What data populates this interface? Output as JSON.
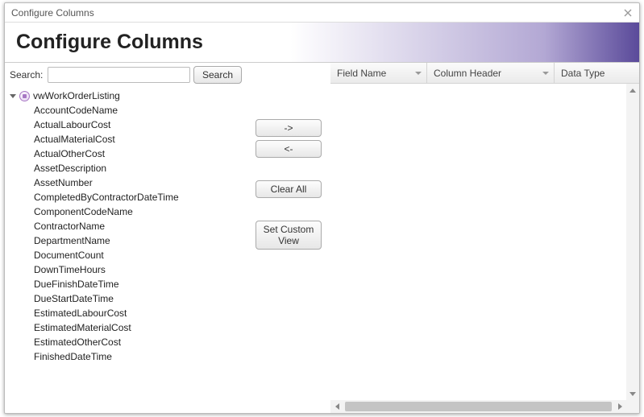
{
  "titlebar": {
    "title": "Configure Columns"
  },
  "header": {
    "title": "Configure Columns"
  },
  "search": {
    "label": "Search:",
    "value": "",
    "button": "Search"
  },
  "tree": {
    "root": "vwWorkOrderListing",
    "items": [
      "AccountCodeName",
      "ActualLabourCost",
      "ActualMaterialCost",
      "ActualOtherCost",
      "AssetDescription",
      "AssetNumber",
      "CompletedByContractorDateTime",
      "ComponentCodeName",
      "ContractorName",
      "DepartmentName",
      "DocumentCount",
      "DownTimeHours",
      "DueFinishDateTime",
      "DueStartDateTime",
      "EstimatedLabourCost",
      "EstimatedMaterialCost",
      "EstimatedOtherCost",
      "FinishedDateTime"
    ]
  },
  "buttons": {
    "add": "->",
    "remove": "<-",
    "clear": "Clear All",
    "custom": "Set Custom View"
  },
  "grid": {
    "columns": {
      "field": "Field Name",
      "header": "Column Header",
      "type": "Data Type"
    }
  }
}
